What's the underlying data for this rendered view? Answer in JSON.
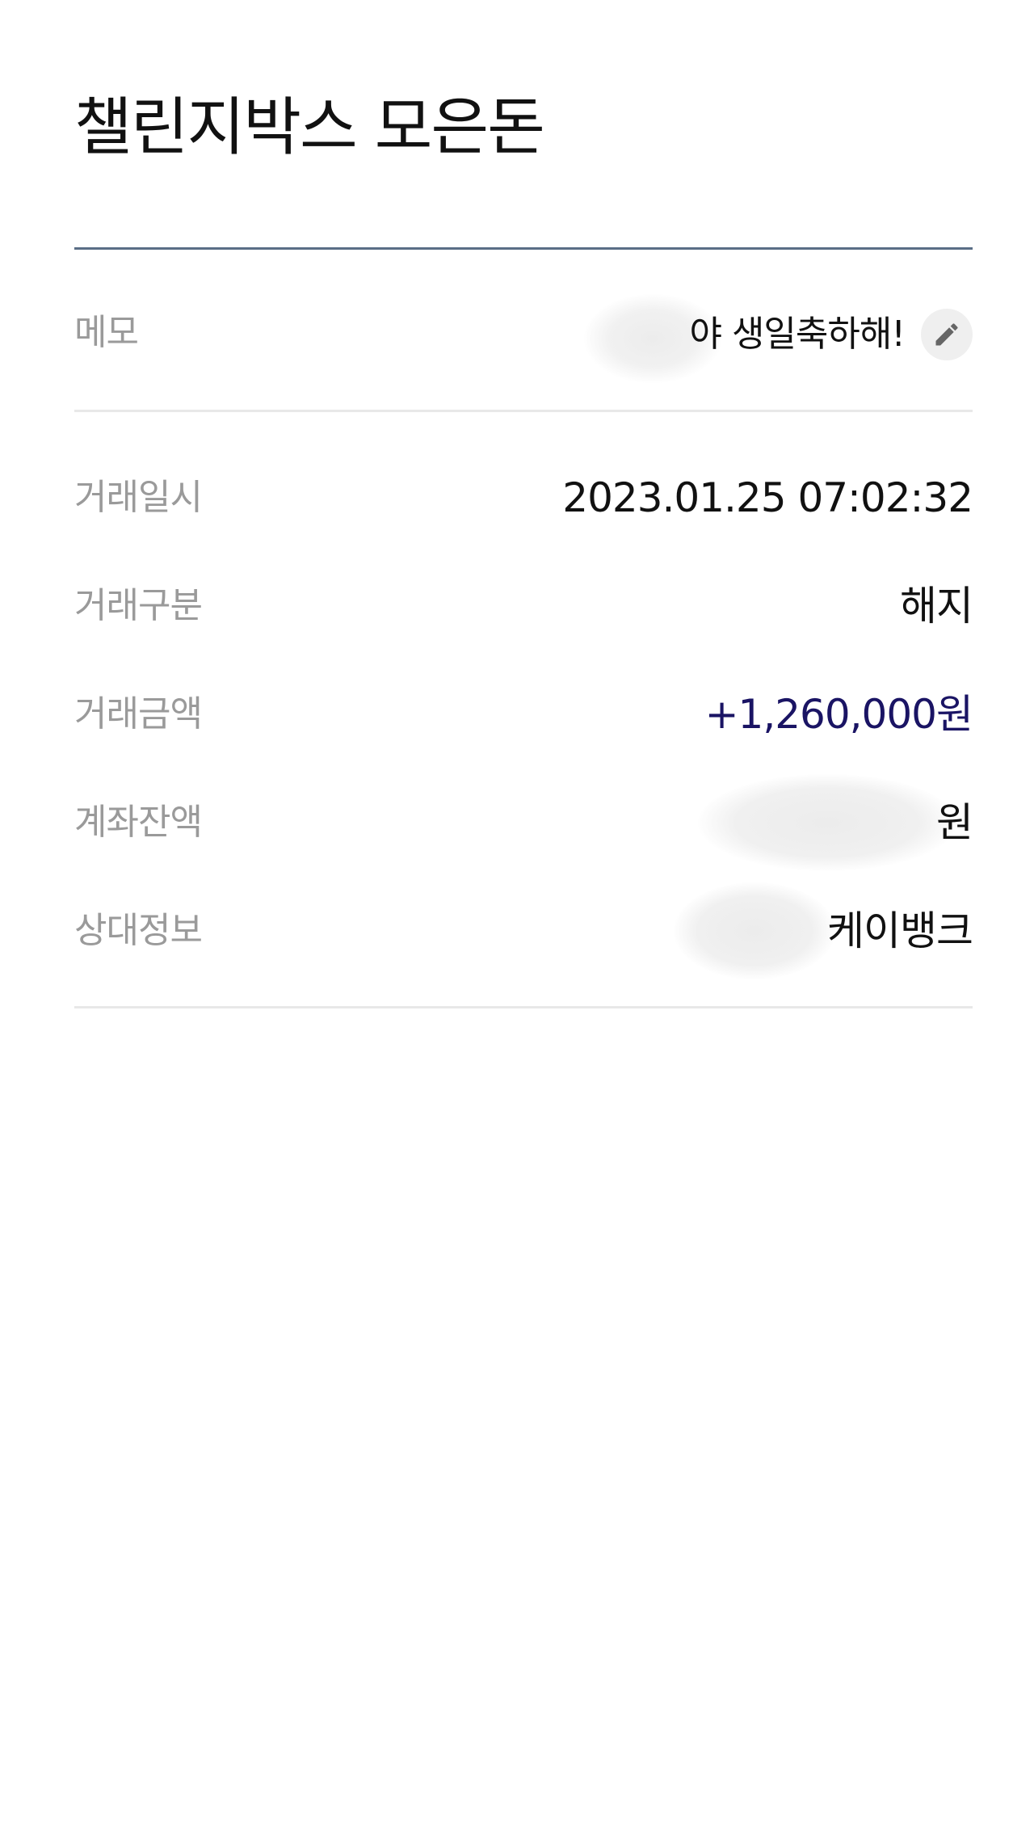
{
  "header": {
    "title": "챌린지박스 모은돈"
  },
  "memo": {
    "label": "메모",
    "value": "야 생일축하해!",
    "edit_icon": "pencil-icon"
  },
  "details": {
    "date": {
      "label": "거래일시",
      "value": "2023.01.25 07:02:32"
    },
    "type": {
      "label": "거래구분",
      "value": "해지"
    },
    "amount": {
      "label": "거래금액",
      "value": "+1,260,000원"
    },
    "balance": {
      "label": "계좌잔액",
      "value": "원"
    },
    "counterparty": {
      "label": "상대정보",
      "value": "케이뱅크"
    }
  },
  "colors": {
    "amount": "#1a1464",
    "divider_strong": "#5a6e86",
    "label": "#9a9a9a"
  }
}
